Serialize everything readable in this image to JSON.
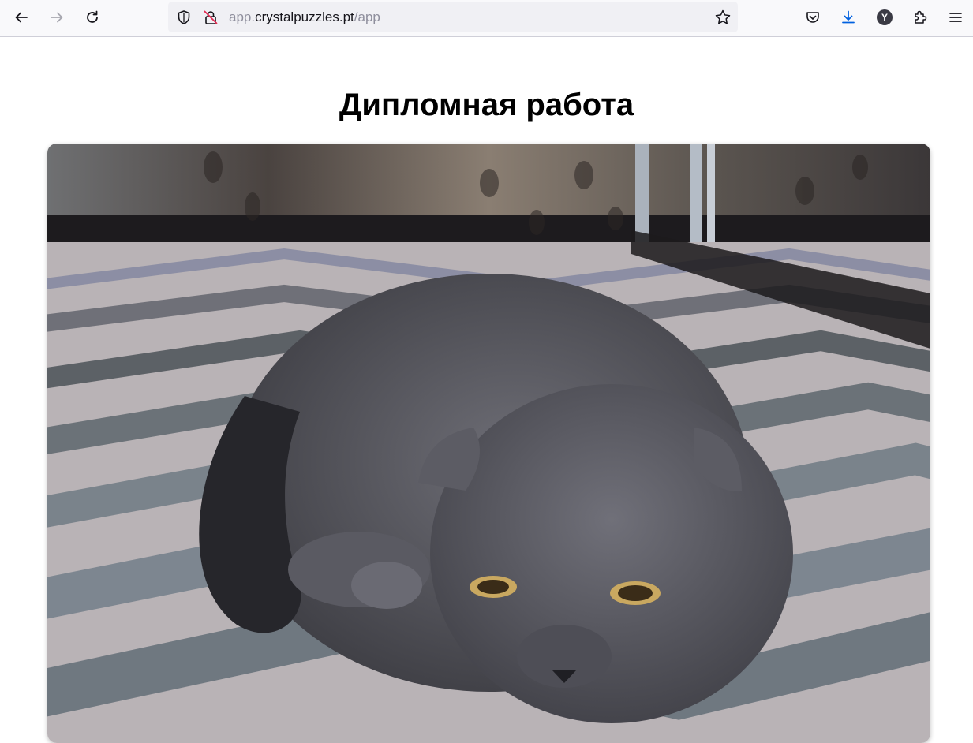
{
  "browser": {
    "url_prefix": "app.",
    "url_host": "crystalpuzzles.pt",
    "url_path": "/app",
    "profile_initial": "Y",
    "icons": {
      "back": "back-arrow-icon",
      "forward": "forward-arrow-icon",
      "reload": "reload-icon",
      "tracking": "shield-icon",
      "insecure": "insecure-lock-icon",
      "bookmark": "star-icon",
      "pocket": "pocket-icon",
      "downloads": "download-icon",
      "extensions": "puzzle-icon",
      "menu": "hamburger-menu-icon"
    },
    "colors": {
      "download_accent": "#0061e0",
      "toolbar_bg": "#f9f9fb",
      "urlbar_bg": "#f0f0f4"
    }
  },
  "page": {
    "title": "Дипломная работа"
  }
}
